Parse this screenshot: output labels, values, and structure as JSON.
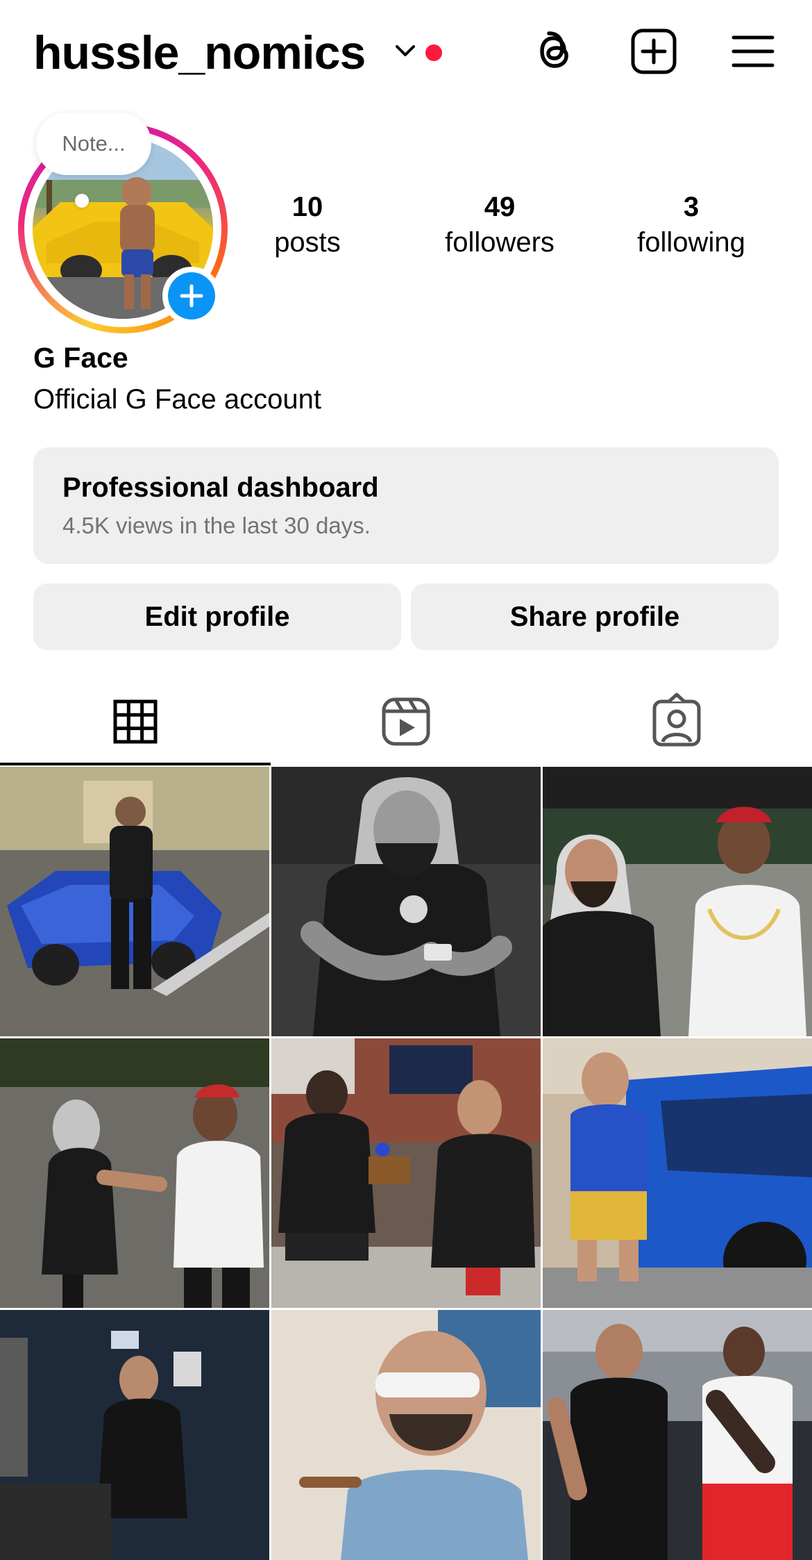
{
  "header": {
    "username": "hussle_nomics",
    "icons": [
      "chevron-down-icon",
      "notification-dot",
      "threads-icon",
      "create-post-icon",
      "menu-icon"
    ]
  },
  "profile": {
    "note_placeholder": "Note...",
    "stats": [
      {
        "value": "10",
        "label": "posts"
      },
      {
        "value": "49",
        "label": "followers"
      },
      {
        "value": "3",
        "label": "following"
      }
    ],
    "display_name": "G Face",
    "bio": "Official G Face account"
  },
  "dashboard": {
    "title": "Professional dashboard",
    "subtitle": "4.5K views in the last 30 days."
  },
  "actions": {
    "edit_label": "Edit profile",
    "share_label": "Share profile"
  },
  "tabs": [
    {
      "icon": "grid-icon",
      "active": true
    },
    {
      "icon": "reels-icon",
      "active": false
    },
    {
      "icon": "tagged-icon",
      "active": false
    }
  ],
  "colors": {
    "accent_blue": "#0a95f6",
    "notification_red": "#ff1a3d",
    "button_bg": "#efefef",
    "muted_text": "#737373"
  },
  "posts": [
    {
      "id": 1,
      "theme": "color",
      "subject": "man-with-blue-sports-car"
    },
    {
      "id": 2,
      "theme": "monochrome",
      "subject": "man-in-puffer-vest-with-phone"
    },
    {
      "id": 3,
      "theme": "color",
      "subject": "two-men-talking-outdoors"
    },
    {
      "id": 4,
      "theme": "color",
      "subject": "two-men-talking-at-night"
    },
    {
      "id": 5,
      "theme": "color",
      "subject": "podcast-studio-two-men"
    },
    {
      "id": 6,
      "theme": "color",
      "subject": "man-by-blue-car"
    },
    {
      "id": 7,
      "theme": "color",
      "subject": "man-in-studio"
    },
    {
      "id": 8,
      "theme": "color",
      "subject": "man-with-sunglasses-and-cigar"
    },
    {
      "id": 9,
      "theme": "color",
      "subject": "two-men-with-cars"
    }
  ]
}
